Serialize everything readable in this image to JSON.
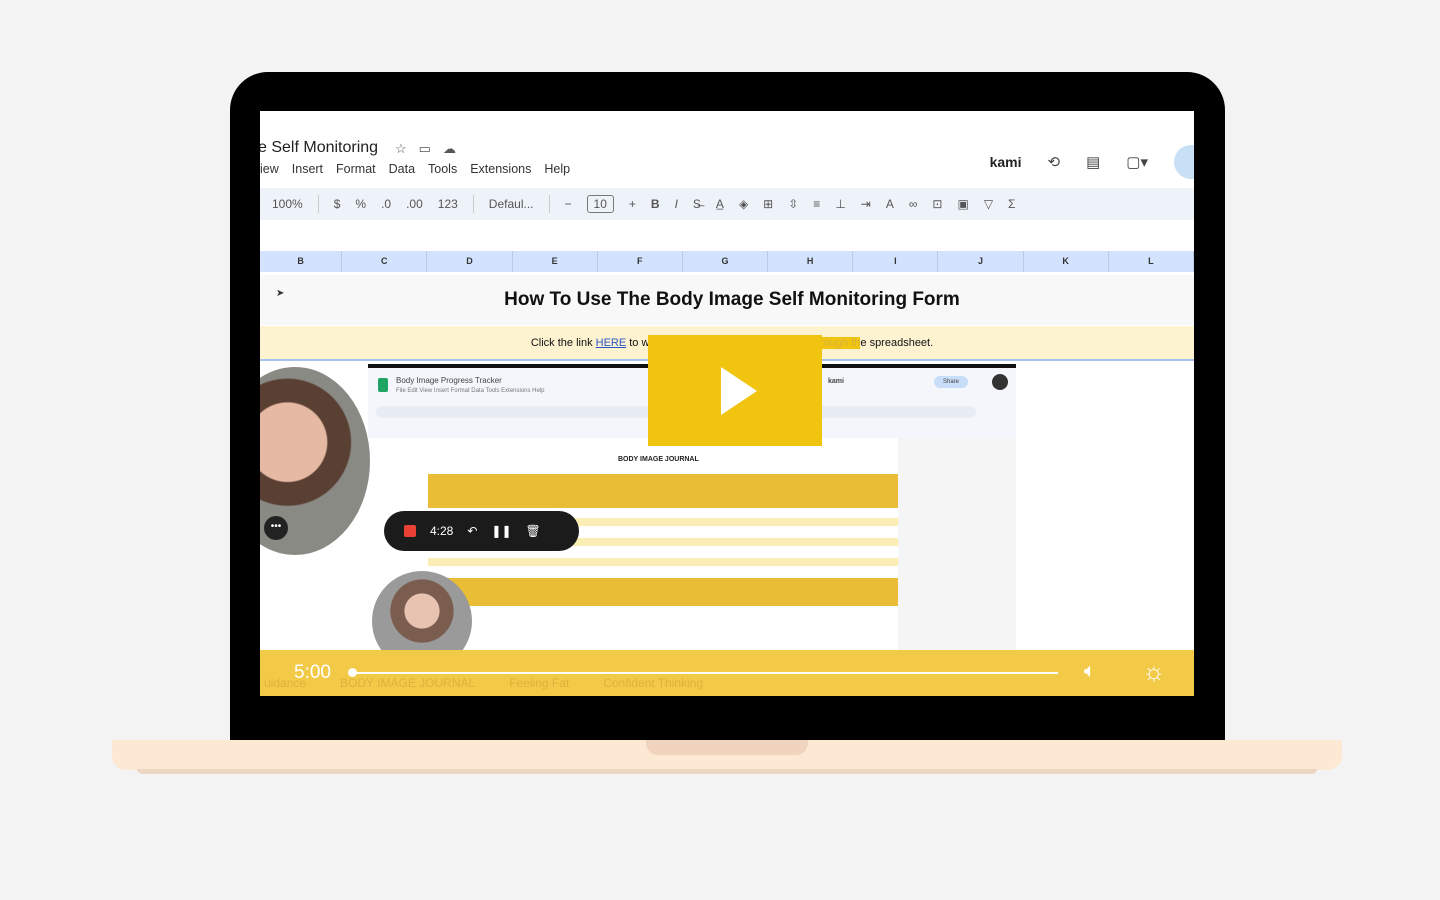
{
  "sheet": {
    "title": "e Self Monitoring",
    "menu": [
      "iew",
      "Insert",
      "Format",
      "Data",
      "Tools",
      "Extensions",
      "Help"
    ],
    "toolbar": {
      "zoom": "100%",
      "currency": "$",
      "percent": "%",
      "dec_less": ".0",
      "dec_more": ".00",
      "format_123": "123",
      "font": "Defaul...",
      "font_size": "10",
      "bold": "B",
      "italic": "I"
    },
    "brand": "kami",
    "columns": [
      "B",
      "C",
      "D",
      "E",
      "F",
      "G",
      "H",
      "I",
      "J",
      "K",
      "L"
    ],
    "heading": "How To Use The Body Image Self Monitoring Form",
    "note": {
      "before": "Click the link ",
      "link": "HERE",
      "middle": " to watch this ",
      "highlighted": "short video walking you through th",
      "after": "e spreadsheet."
    }
  },
  "video": {
    "inner_title": "Body Image Progress Tracker",
    "inner_menu": "File  Edit  View  Insert  Format  Data  Tools  Extensions  Help",
    "inner_brand": "kami",
    "share": "Share",
    "journal_title": "BODY IMAGE JOURNAL",
    "recorder_time": "4:28",
    "controls": {
      "time": "5:00",
      "progress": 0.0
    },
    "tabs": [
      "uidance",
      "BODY IMAGE JOURNAL",
      "Feeling Fat",
      "Confident Thinking"
    ]
  }
}
